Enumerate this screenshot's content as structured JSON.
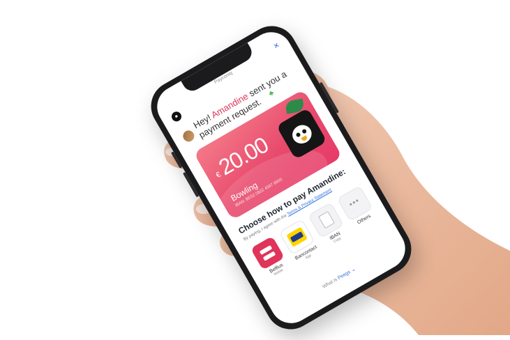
{
  "app": {
    "status_title": "Payconiq",
    "close_icon": "close-icon",
    "logo_icon": "app-logo-icon"
  },
  "message": {
    "greeting": "Hey! ",
    "sender": "Amandine",
    "rest": " sent you a payment request.",
    "emoji_icon": "clover-icon"
  },
  "card": {
    "currency": "€",
    "amount": "20.00",
    "label": "Bowling",
    "iban": "IBAN: BE52 0822 4587 8900",
    "mascot_icon": "penguin-mascot-icon",
    "accent_color": "#e73b68"
  },
  "payment": {
    "heading": "Choose how to pay Amandine:",
    "agree_prefix": "By paying, I agree with the ",
    "agree_link": "Terms & Privacy Statement",
    "methods": [
      {
        "label": "Belfius",
        "sub": "Mobile",
        "icon": "belfius-icon"
      },
      {
        "label": "Bancontact",
        "sub": "App",
        "icon": "bancontact-icon"
      },
      {
        "label": "IBAN",
        "sub": "Copy",
        "icon": "copy-icon"
      },
      {
        "label": "Others",
        "sub": "",
        "icon": "more-icon"
      }
    ]
  },
  "footer": {
    "prefix": "What is ",
    "brand": "Peegs",
    "icon": "chevron-down-icon"
  }
}
